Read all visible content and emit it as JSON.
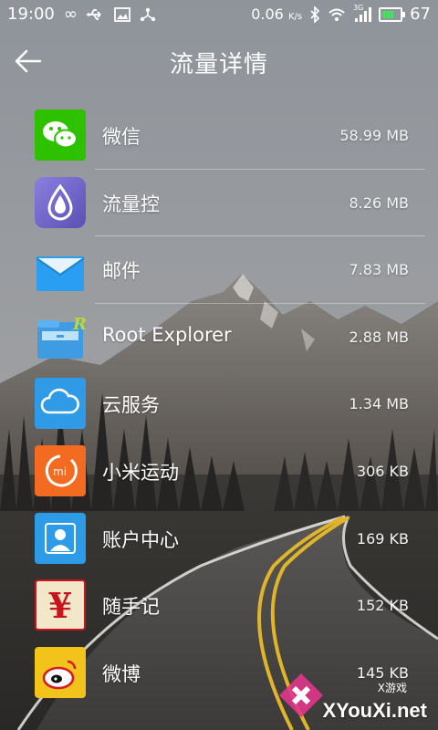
{
  "status_bar": {
    "time": "19:00",
    "network_speed": "0.06",
    "network_speed_unit": "K/s",
    "battery": "67",
    "signal_label": "3G"
  },
  "header": {
    "title": "流量详情"
  },
  "apps": [
    {
      "name": "微信",
      "usage": "58.99 MB",
      "icon": "wechat-icon",
      "color": "#2dc100"
    },
    {
      "name": "流量控",
      "usage": "8.26 MB",
      "icon": "traffic-control-icon",
      "color": "#6a5fc8"
    },
    {
      "name": "邮件",
      "usage": "7.83 MB",
      "icon": "mail-icon",
      "color": "#1e95e3"
    },
    {
      "name": "Root Explorer",
      "usage": "2.88 MB",
      "icon": "folder-icon",
      "color": "#4aa8e8"
    },
    {
      "name": "云服务",
      "usage": "1.34 MB",
      "icon": "cloud-icon",
      "color": "#2f9ae6"
    },
    {
      "name": "小米运动",
      "usage": "306 KB",
      "icon": "mi-fit-icon",
      "color": "#f36b21"
    },
    {
      "name": "账户中心",
      "usage": "169 KB",
      "icon": "account-icon",
      "color": "#2d9be6"
    },
    {
      "name": "随手记",
      "usage": "152 KB",
      "icon": "yen-icon",
      "color": "#c8141c"
    },
    {
      "name": "微博",
      "usage": "145 KB",
      "icon": "weibo-icon",
      "color": "#f2b41a"
    }
  ],
  "watermark": {
    "brand": "XYouXi.net",
    "sub": "X游戏"
  }
}
